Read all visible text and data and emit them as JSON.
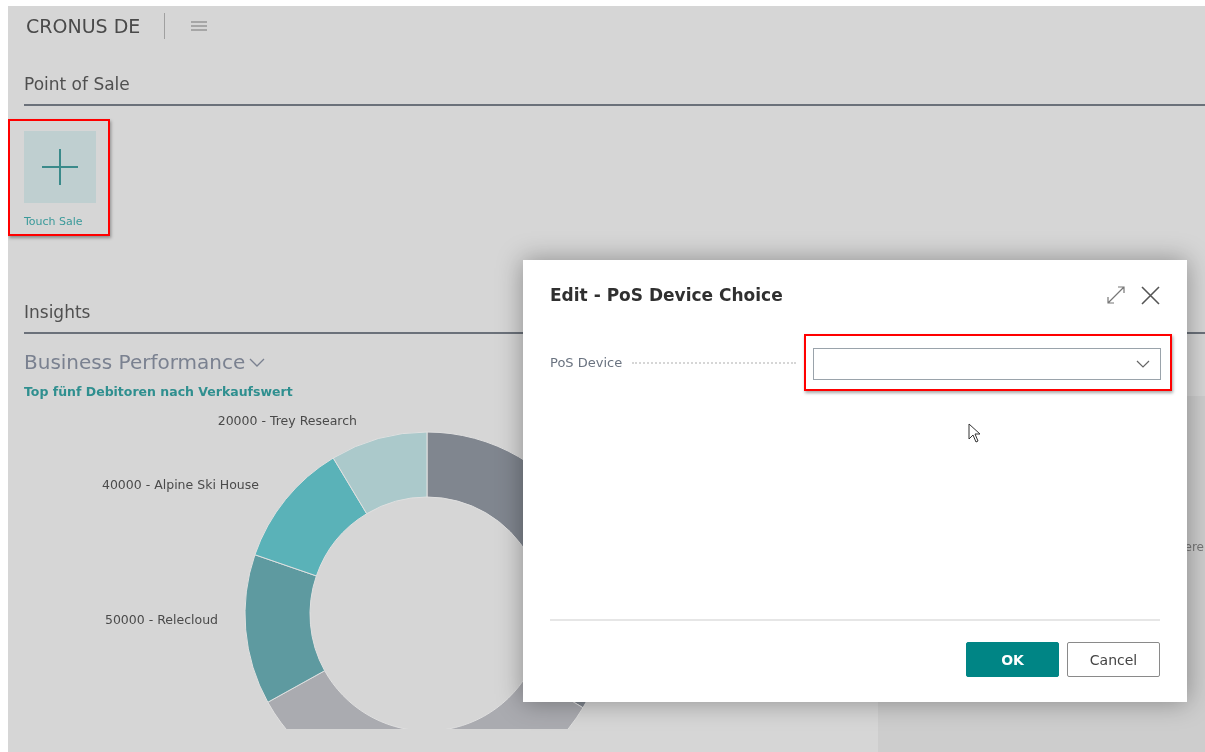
{
  "header": {
    "company": "CRONUS DE"
  },
  "point_of_sale": {
    "title": "Point of Sale",
    "tiles": [
      {
        "label": "Touch Sale",
        "highlighted": true
      }
    ]
  },
  "insights": {
    "title": "Insights",
    "part_title": "Business Performance",
    "chart_title": "Top fünf Debitoren nach Verkaufswert",
    "chart_labels": [
      "20000 - Trey Research",
      "40000 - Alpine Ski House",
      "50000 - Relecloud"
    ],
    "side_card_text": "ere"
  },
  "dialog": {
    "title": "Edit - PoS Device Choice",
    "fields": [
      {
        "label": "PoS Device",
        "kind": "dropdown",
        "highlighted": true
      }
    ],
    "buttons": [
      {
        "label": "OK",
        "kind": "primary"
      },
      {
        "label": "Cancel",
        "kind": "secondary"
      }
    ]
  }
}
